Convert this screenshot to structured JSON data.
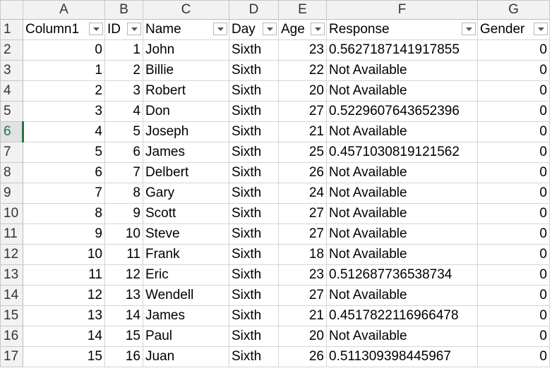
{
  "column_letters": [
    "A",
    "B",
    "C",
    "D",
    "E",
    "F",
    "G"
  ],
  "headers": [
    "Column1",
    "ID",
    "Name",
    "Day",
    "Age",
    "Response",
    "Gender"
  ],
  "selected_row": "6",
  "rows": [
    {
      "n": "2",
      "c": [
        "0",
        "1",
        "John",
        "Sixth",
        "23",
        "0.5627187141917855",
        "0"
      ]
    },
    {
      "n": "3",
      "c": [
        "1",
        "2",
        "Billie",
        "Sixth",
        "22",
        "Not Available",
        "0"
      ]
    },
    {
      "n": "4",
      "c": [
        "2",
        "3",
        "Robert",
        "Sixth",
        "20",
        "Not Available",
        "0"
      ]
    },
    {
      "n": "5",
      "c": [
        "3",
        "4",
        "Don",
        "Sixth",
        "27",
        "0.5229607643652396",
        "0"
      ]
    },
    {
      "n": "6",
      "c": [
        "4",
        "5",
        "Joseph",
        "Sixth",
        "21",
        "Not Available",
        "0"
      ]
    },
    {
      "n": "7",
      "c": [
        "5",
        "6",
        "James",
        "Sixth",
        "25",
        "0.4571030819121562",
        "0"
      ]
    },
    {
      "n": "8",
      "c": [
        "6",
        "7",
        "Delbert",
        "Sixth",
        "26",
        "Not Available",
        "0"
      ]
    },
    {
      "n": "9",
      "c": [
        "7",
        "8",
        "Gary",
        "Sixth",
        "24",
        "Not Available",
        "0"
      ]
    },
    {
      "n": "10",
      "c": [
        "8",
        "9",
        "Scott",
        "Sixth",
        "27",
        "Not Available",
        "0"
      ]
    },
    {
      "n": "11",
      "c": [
        "9",
        "10",
        "Steve",
        "Sixth",
        "27",
        "Not Available",
        "0"
      ]
    },
    {
      "n": "12",
      "c": [
        "10",
        "11",
        "Frank",
        "Sixth",
        "18",
        "Not Available",
        "0"
      ]
    },
    {
      "n": "13",
      "c": [
        "11",
        "12",
        "Eric",
        "Sixth",
        "23",
        "0.512687736538734",
        "0"
      ]
    },
    {
      "n": "14",
      "c": [
        "12",
        "13",
        "Wendell",
        "Sixth",
        "27",
        "Not Available",
        "0"
      ]
    },
    {
      "n": "15",
      "c": [
        "13",
        "14",
        "James",
        "Sixth",
        "21",
        "0.4517822116966478",
        "0"
      ]
    },
    {
      "n": "16",
      "c": [
        "14",
        "15",
        "Paul",
        "Sixth",
        "20",
        "Not Available",
        "0"
      ]
    },
    {
      "n": "17",
      "c": [
        "15",
        "16",
        "Juan",
        "Sixth",
        "26",
        "0.511309398445967",
        "0"
      ]
    }
  ]
}
